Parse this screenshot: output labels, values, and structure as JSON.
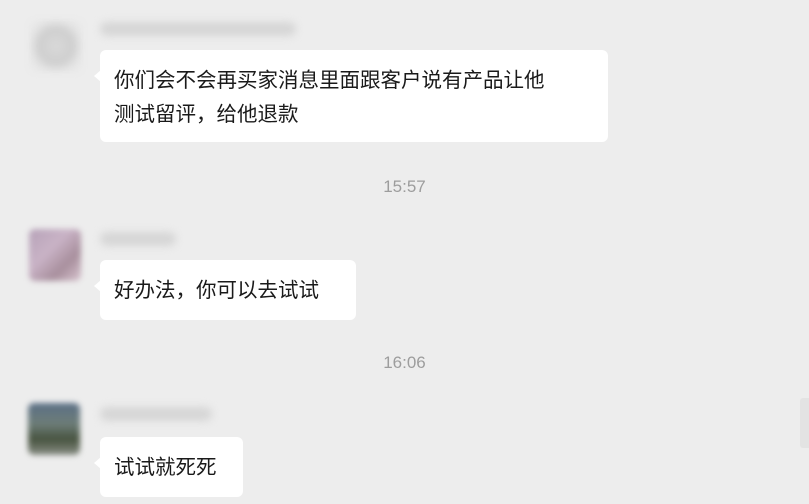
{
  "messages": [
    {
      "sender_name": "",
      "text": "你们会不会再买家消息里面跟客户说有产品让他\n测试留评，给他退款"
    },
    {
      "sender_name": "",
      "text": "好办法，你可以去试试"
    },
    {
      "sender_name": "",
      "text": "试试就死死"
    }
  ],
  "timestamps": [
    "15:57",
    "16:06"
  ],
  "colors": {
    "background": "#ededed",
    "bubble": "#ffffff",
    "timestamp_text": "#9d9d9d",
    "message_text": "#1a1a1a"
  }
}
